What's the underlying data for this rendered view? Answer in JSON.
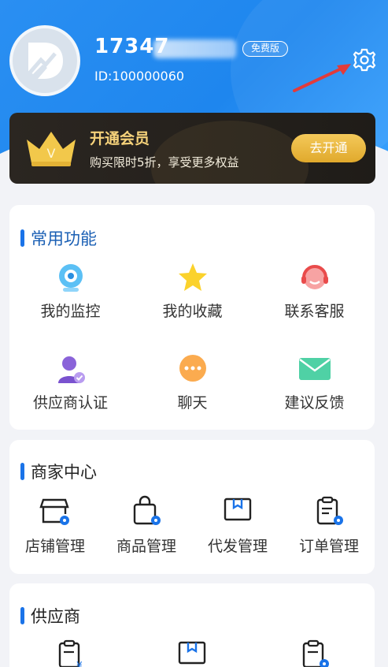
{
  "profile": {
    "username": "17347",
    "badge": "免费版",
    "user_id": "ID:100000060"
  },
  "vip": {
    "title": "开通会员",
    "subtitle": "购买限时5折，享受更多权益",
    "button": "去开通",
    "crown_letter": "V"
  },
  "common": {
    "title": "常用功能",
    "items": [
      {
        "label": "我的监控",
        "icon": "camera-icon"
      },
      {
        "label": "我的收藏",
        "icon": "star-icon"
      },
      {
        "label": "联系客服",
        "icon": "headset-icon"
      },
      {
        "label": "供应商认证",
        "icon": "user-verify-icon"
      },
      {
        "label": "聊天",
        "icon": "chat-icon"
      },
      {
        "label": "建议反馈",
        "icon": "mail-icon"
      }
    ]
  },
  "merchant": {
    "title": "商家中心",
    "items": [
      {
        "label": "店铺管理",
        "icon": "shop-icon"
      },
      {
        "label": "商品管理",
        "icon": "bag-icon"
      },
      {
        "label": "代发管理",
        "icon": "box-icon"
      },
      {
        "label": "订单管理",
        "icon": "clipboard-icon"
      }
    ]
  },
  "supplier": {
    "title": "供应商",
    "items": [
      {
        "icon": "clipboard-yen-icon"
      },
      {
        "icon": "box-icon"
      },
      {
        "icon": "clipboard-gear-icon"
      }
    ]
  },
  "colors": {
    "header_blue": "#1e86ee",
    "accent_blue": "#1a73e8",
    "vip_gold": "#f6d27a",
    "vip_button": "#e6b03a"
  }
}
